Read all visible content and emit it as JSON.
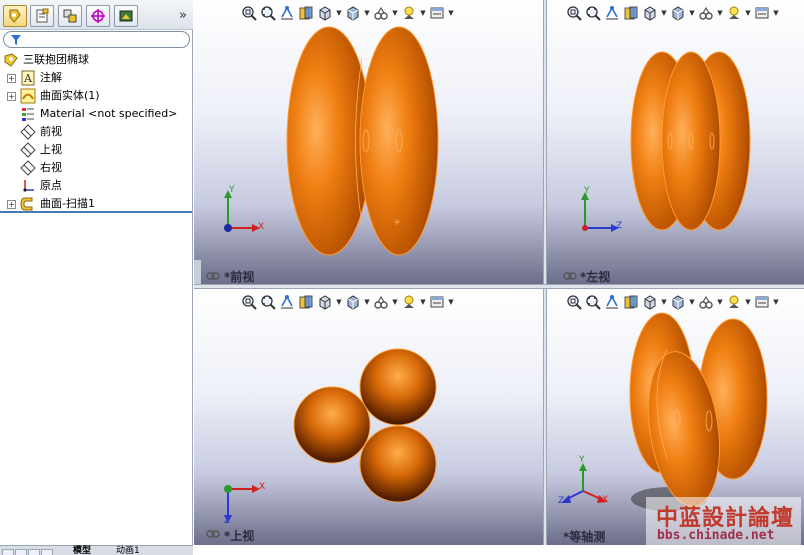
{
  "feature_manager": {
    "tree": [
      {
        "name": "part-root",
        "label": "三联抱团椭球",
        "expandable": false,
        "icon": "part-icon"
      },
      {
        "name": "annotations",
        "label": "注解",
        "expandable": true,
        "icon": "annotation-icon"
      },
      {
        "name": "surface-bodies",
        "label": "曲面实体(1)",
        "expandable": true,
        "icon": "surface-body-icon"
      },
      {
        "name": "material",
        "label": "Material <not specified>",
        "expandable": false,
        "icon": "material-icon"
      },
      {
        "name": "front-plane",
        "label": "前视",
        "expandable": false,
        "icon": "plane-icon"
      },
      {
        "name": "top-plane",
        "label": "上视",
        "expandable": false,
        "icon": "plane-icon"
      },
      {
        "name": "right-plane",
        "label": "右视",
        "expandable": false,
        "icon": "plane-icon"
      },
      {
        "name": "origin",
        "label": "原点",
        "expandable": false,
        "icon": "origin-icon"
      },
      {
        "name": "surface-sweep",
        "label": "曲面-扫描1",
        "expandable": true,
        "icon": "sweep-icon"
      }
    ],
    "more_chevron": "»",
    "bottom_tabs": [
      "模型",
      "动画1"
    ]
  },
  "viewports": {
    "front": {
      "label": "*前视"
    },
    "left": {
      "label": "*左视"
    },
    "top": {
      "label": "*上视"
    },
    "iso": {
      "label": "*等轴测"
    }
  },
  "triad_axes": {
    "x": "X",
    "y": "Y",
    "z": "Z"
  },
  "watermark": {
    "title": "中蓝設計論壇",
    "url": "bbs.chinade.net"
  },
  "colors": {
    "model": "#e07a10",
    "model_edge": "#ff9a30",
    "panel_accent": "#4a78b5"
  }
}
